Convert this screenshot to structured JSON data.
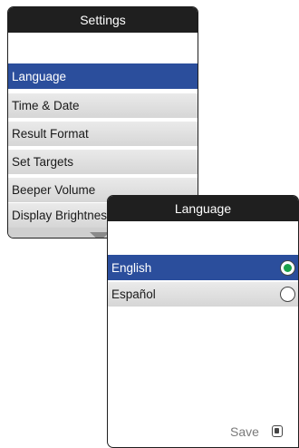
{
  "settings_screen": {
    "title": "Settings",
    "items": [
      {
        "label": "Language",
        "selected": true
      },
      {
        "label": "Time & Date",
        "selected": false
      },
      {
        "label": "Result Format",
        "selected": false
      },
      {
        "label": "Set Targets",
        "selected": false
      },
      {
        "label": "Beeper Volume",
        "selected": false
      },
      {
        "label": "Display Brightness",
        "selected": false
      }
    ],
    "scroll_icon": "chevron-down-icon"
  },
  "language_screen": {
    "title": "Language",
    "options": [
      {
        "label": "English",
        "selected": true
      },
      {
        "label": "Español",
        "selected": false
      }
    ],
    "save_label": "Save",
    "save_icon": "save-button-icon"
  },
  "colors": {
    "titlebar": "#1f1f1f",
    "selection": "#2b4e9c",
    "radio_selected": "#1aa24a"
  }
}
